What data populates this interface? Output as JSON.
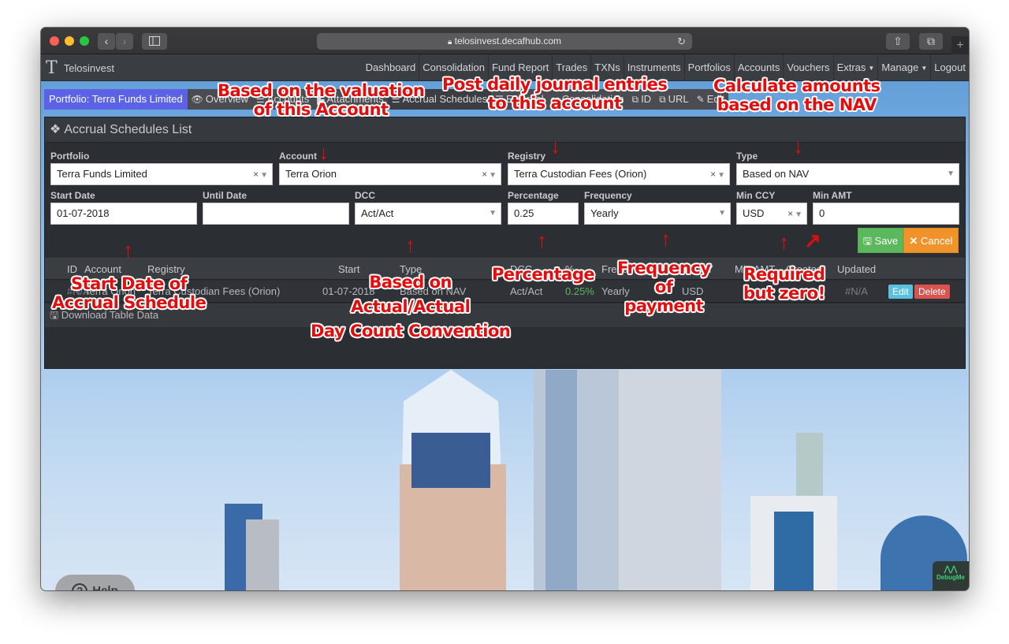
{
  "browser": {
    "url": "telosinvest.decafhub.com",
    "back_icon": "‹",
    "forward_icon": "›",
    "new_tab_icon": "+"
  },
  "navbar": {
    "brand": "Telosinvest",
    "items": [
      {
        "label": "Dashboard"
      },
      {
        "label": "Consolidation"
      },
      {
        "label": "Fund Report"
      },
      {
        "label": "Trades"
      },
      {
        "label": "TXNs"
      },
      {
        "label": "Instruments"
      },
      {
        "label": "Portfolios"
      },
      {
        "label": "Accounts"
      },
      {
        "label": "Vouchers"
      },
      {
        "label": "Extras",
        "dropdown": true
      },
      {
        "label": "Manage",
        "dropdown": true
      },
      {
        "label": "Logout"
      }
    ]
  },
  "subnav": {
    "portfolio": "Portfolio: Terra Funds Limited",
    "items": [
      {
        "label": "Overview",
        "icon": "eye-icon"
      },
      {
        "label": "Accounts",
        "icon": "list-icon"
      },
      {
        "label": "Attachments",
        "icon": "paperclip-icon"
      },
      {
        "label": "Accrual Schedules",
        "icon": "list-icon",
        "active": true
      },
      {
        "label": "External",
        "icon": "list-icon"
      },
      {
        "label": "Consolidation",
        "icon": "link-icon"
      },
      {
        "label": "ID",
        "icon": "copy-icon"
      },
      {
        "label": "URL",
        "icon": "copy-icon"
      },
      {
        "label": "Edit",
        "icon": "edit-icon"
      }
    ]
  },
  "panel": {
    "title": "Accrual Schedules List"
  },
  "form": {
    "portfolio": {
      "label": "Portfolio",
      "value": "Terra Funds Limited"
    },
    "account": {
      "label": "Account",
      "value": "Terra Orion"
    },
    "registry": {
      "label": "Registry",
      "value": "Terra Custodian Fees (Orion)"
    },
    "type": {
      "label": "Type",
      "value": "Based on NAV"
    },
    "start_date": {
      "label": "Start Date",
      "value": "01-07-2018"
    },
    "until_date": {
      "label": "Until Date",
      "value": ""
    },
    "dcc": {
      "label": "DCC",
      "value": "Act/Act"
    },
    "percentage": {
      "label": "Percentage",
      "value": "0.25"
    },
    "frequency": {
      "label": "Frequency",
      "value": "Yearly"
    },
    "min_ccy": {
      "label": "Min CCY",
      "value": "USD"
    },
    "min_amt": {
      "label": "Min AMT",
      "value": "0"
    },
    "save_label": "Save",
    "cancel_label": "Cancel"
  },
  "table": {
    "headers": [
      "ID",
      "Account",
      "Registry",
      "Start",
      "Type",
      "DCC",
      "%",
      "Frequency",
      "Min CCY",
      "Min AMT",
      "Created",
      "Updated"
    ],
    "rows": [
      {
        "id": "#N/A",
        "account": "Terra Orion",
        "registry": "Terra Custodian Fees (Orion)",
        "start": "01-07-2018",
        "type": "Based on NAV",
        "dcc": "Act/Act",
        "percentage": "0.25%",
        "frequency": "Yearly",
        "min_ccy": "USD",
        "min_amt": "",
        "created": "",
        "updated": "#N/A",
        "edit_label": "Edit",
        "delete_label": "Delete"
      }
    ],
    "download_label": "Download Table Data"
  },
  "widgets": {
    "help_label": "Help",
    "debug_label": "DebugMe"
  },
  "annotations": {
    "account": [
      "Based on the valuation",
      "of this Account"
    ],
    "registry": [
      "Post daily journal entries",
      "to this account"
    ],
    "type": [
      "Calculate amounts",
      "based on the NAV"
    ],
    "start_date": [
      "Start Date of",
      "Accrual Schedule"
    ],
    "dcc": [
      "Based on",
      "Actual/Actual",
      "Day Count Convention"
    ],
    "percentage": [
      "Percentage"
    ],
    "frequency": [
      "Frequency",
      "of",
      "payment"
    ],
    "min_amt": [
      "Required",
      "but zero!"
    ]
  },
  "colors": {
    "portfolio_badge": "#5b62e6",
    "save": "#5cb85c",
    "cancel": "#f0932b",
    "edit": "#5bc0de",
    "delete": "#d9534f",
    "percentage_text": "#5cb85c",
    "annotation": "#e20d0d"
  }
}
